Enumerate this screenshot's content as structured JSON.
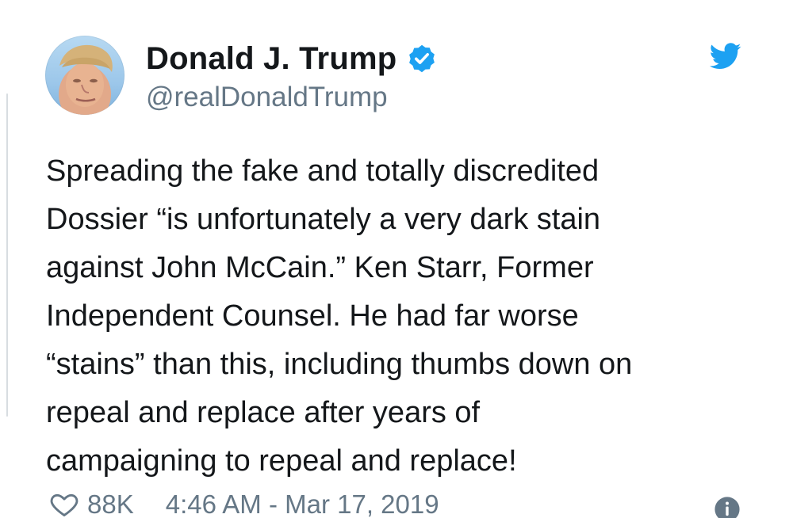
{
  "user": {
    "display_name": "Donald J. Trump",
    "handle": "@realDonaldTrump",
    "verified": true,
    "avatar_icon": "profile-photo"
  },
  "tweet": {
    "lines": [
      "Spreading the fake and totally discredited",
      "Dossier “is unfortunately a very dark stain",
      "against John McCain.” Ken Starr, Former",
      "Independent Counsel. He had far worse",
      "“stains” than this, including thumbs down on",
      "repeal and replace after years of",
      "campaigning to repeal and replace!"
    ]
  },
  "meta": {
    "likes": "88K",
    "timestamp": "4:46 AM - Mar 17, 2019"
  },
  "icons": {
    "brand": "twitter-bird-icon",
    "verified": "verified-badge-icon",
    "like": "heart-icon",
    "info": "info-icon"
  },
  "colors": {
    "twitter_blue": "#1da1f2",
    "text_primary": "#14171a",
    "text_secondary": "#657786"
  }
}
